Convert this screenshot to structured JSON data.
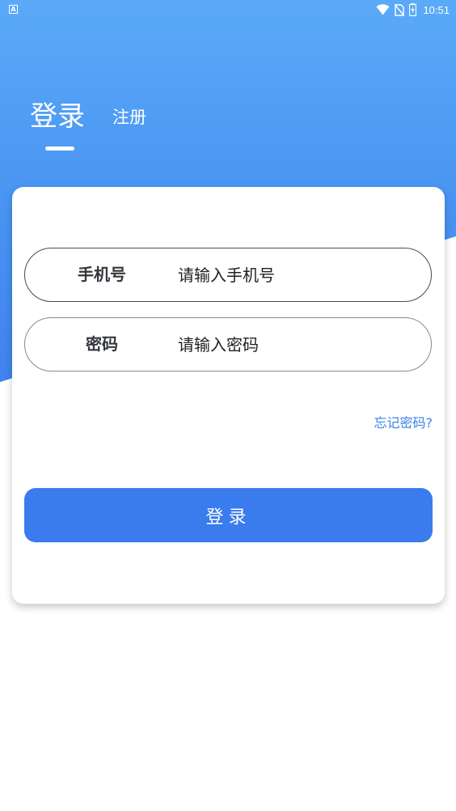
{
  "status_bar": {
    "app_icon_letter": "A",
    "time": "10:51",
    "icons": [
      "wifi-icon",
      "no-sim-icon",
      "battery-charging-icon"
    ]
  },
  "tabs": {
    "login_label": "登录",
    "register_label": "注册",
    "active": "login"
  },
  "form": {
    "phone_label": "手机号",
    "phone_placeholder": "请输入手机号",
    "phone_value": "",
    "password_label": "密码",
    "password_placeholder": "请输入密码",
    "password_value": "",
    "forgot_label": "忘记密码?",
    "submit_label": "登录"
  },
  "colors": {
    "header_gradient_top": "#5aaaf8",
    "header_gradient_bottom": "#3f82ee",
    "button_blue": "#3a7bed",
    "link_blue": "#3b82ea"
  }
}
